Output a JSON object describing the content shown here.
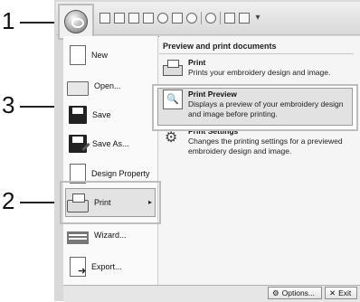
{
  "callouts": [
    "1",
    "2",
    "3"
  ],
  "toolbar": {
    "qat_more_glyph": "▾"
  },
  "menu_left": [
    {
      "label": "New",
      "icon": "new-document-icon"
    },
    {
      "label": "Open...",
      "icon": "open-folder-icon"
    },
    {
      "label": "Save",
      "icon": "save-icon"
    },
    {
      "label": "Save As...",
      "icon": "save-as-icon"
    },
    {
      "label": "Design Property",
      "icon": "design-property-icon"
    },
    {
      "label": "Print",
      "icon": "print-icon"
    },
    {
      "label": "Wizard...",
      "icon": "wizard-icon"
    },
    {
      "label": "Export...",
      "icon": "export-icon"
    }
  ],
  "submenu_arrow": "▸",
  "right": {
    "heading": "Preview and print documents",
    "items": [
      {
        "title": "Print",
        "desc": "Prints your embroidery design and image.",
        "icon": "print-icon"
      },
      {
        "title": "Print Preview",
        "desc": "Displays a preview of your embroidery design and image before printing.",
        "icon": "print-preview-icon"
      },
      {
        "title": "Print Settings",
        "desc": "Changes the printing settings for a previewed embroidery design and image.",
        "icon": "settings-gear-icon"
      }
    ]
  },
  "bottom": {
    "options_label": "Options...",
    "exit_label": "Exit"
  },
  "colors": {
    "highlight_border": "#bdbdbd",
    "highlight_fill": "#e3e3e3",
    "menu_bg": "#f3f3f3"
  }
}
